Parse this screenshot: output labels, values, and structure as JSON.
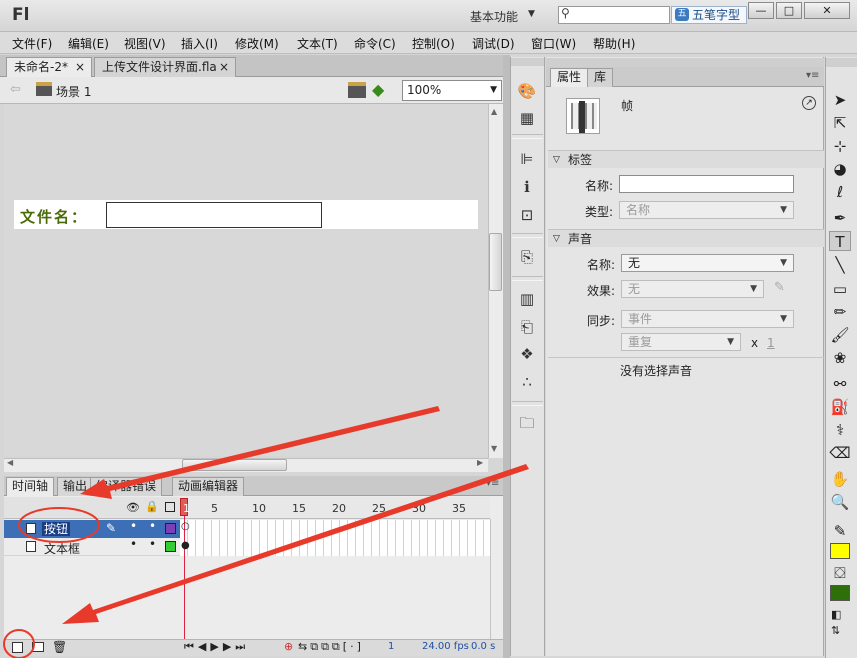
{
  "app": {
    "logo": "Fl",
    "workspace": "基本功能",
    "ime_label": "五笔字型"
  },
  "window_buttons": {
    "minimize": "—",
    "maximize": "□",
    "close": "✕"
  },
  "menu": [
    "文件(F)",
    "编辑(E)",
    "视图(V)",
    "插入(I)",
    "修改(M)",
    "文本(T)",
    "命令(C)",
    "控制(O)",
    "调试(D)",
    "窗口(W)",
    "帮助(H)"
  ],
  "doc_tabs": [
    {
      "label": "未命名-2*",
      "close": "×"
    },
    {
      "label": "上传文件设计界面.fla",
      "close": "×"
    }
  ],
  "edit_bar": {
    "scene": "场景 1",
    "zoom": "100%"
  },
  "stage": {
    "field_label": "文件名："
  },
  "timeline": {
    "tabs": [
      "时间轴",
      "输出",
      "编译器错误",
      "动画编辑器"
    ],
    "ruler": [
      "1",
      "5",
      "10",
      "15",
      "20",
      "25",
      "30",
      "35"
    ],
    "layers": [
      {
        "name": "按钮",
        "color": "#7b3fb6",
        "selected": true
      },
      {
        "name": "文本框",
        "color": "#33cc33",
        "selected": false
      }
    ],
    "footer": {
      "current_frame": "1",
      "fps": "24.00 fps",
      "time": "0.0 s"
    }
  },
  "properties": {
    "tabs": [
      "属性",
      "库"
    ],
    "object_type": "帧",
    "label_section": {
      "title": "标签",
      "name_label": "名称:",
      "name_value": "",
      "type_label": "类型:",
      "type_value": "名称"
    },
    "sound_section": {
      "title": "声音",
      "name_label": "名称:",
      "name_value": "无",
      "effect_label": "效果:",
      "effect_value": "无",
      "sync_label": "同步:",
      "sync_value": "事件",
      "repeat_value": "重复",
      "repeat_x": "x",
      "repeat_count": "1",
      "status": "没有选择声音"
    }
  },
  "colors": {
    "stroke": "#ffff00",
    "fill": "#2f6f0a",
    "annotation": "#e83a2a",
    "layer_selected": "#3d6fb6"
  }
}
